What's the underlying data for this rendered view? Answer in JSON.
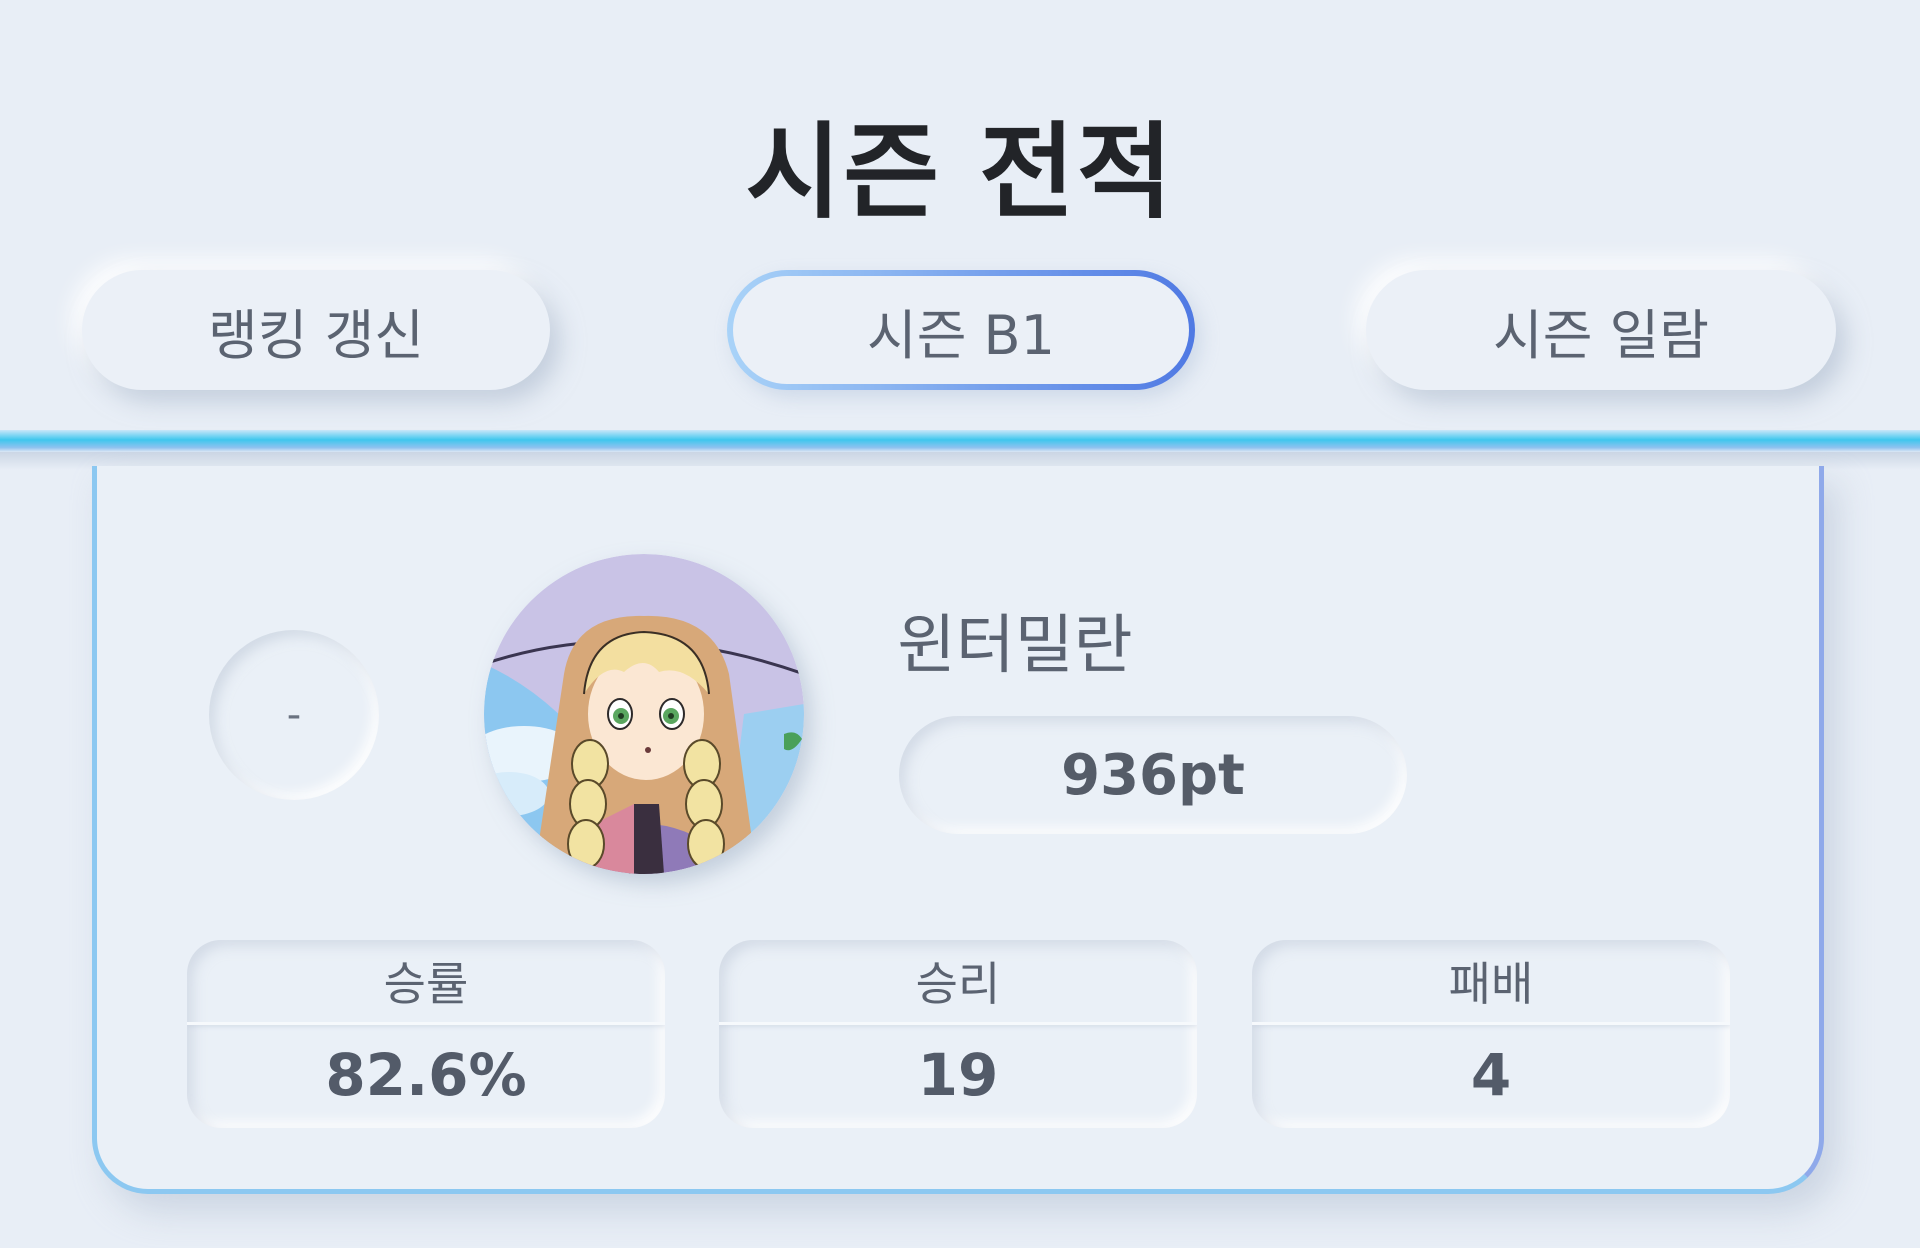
{
  "header": {
    "title": "시즌 전적"
  },
  "tabs": [
    {
      "label": "랭킹 갱신"
    },
    {
      "label": "시즌 B1"
    },
    {
      "label": "시즌 일람"
    }
  ],
  "colors": {
    "background": "#e8eef6",
    "accent_cyan": "#3fc7ee",
    "accent_blue": "#4f79e3",
    "text_dark": "#222428",
    "text_muted": "#5b6371"
  },
  "player": {
    "rank": "-",
    "avatar_icon": "player-avatar",
    "name": "윈터밀란",
    "points": "936pt"
  },
  "stats": [
    {
      "label": "승률",
      "value": "82.6%"
    },
    {
      "label": "승리",
      "value": "19"
    },
    {
      "label": "패배",
      "value": "4"
    }
  ]
}
